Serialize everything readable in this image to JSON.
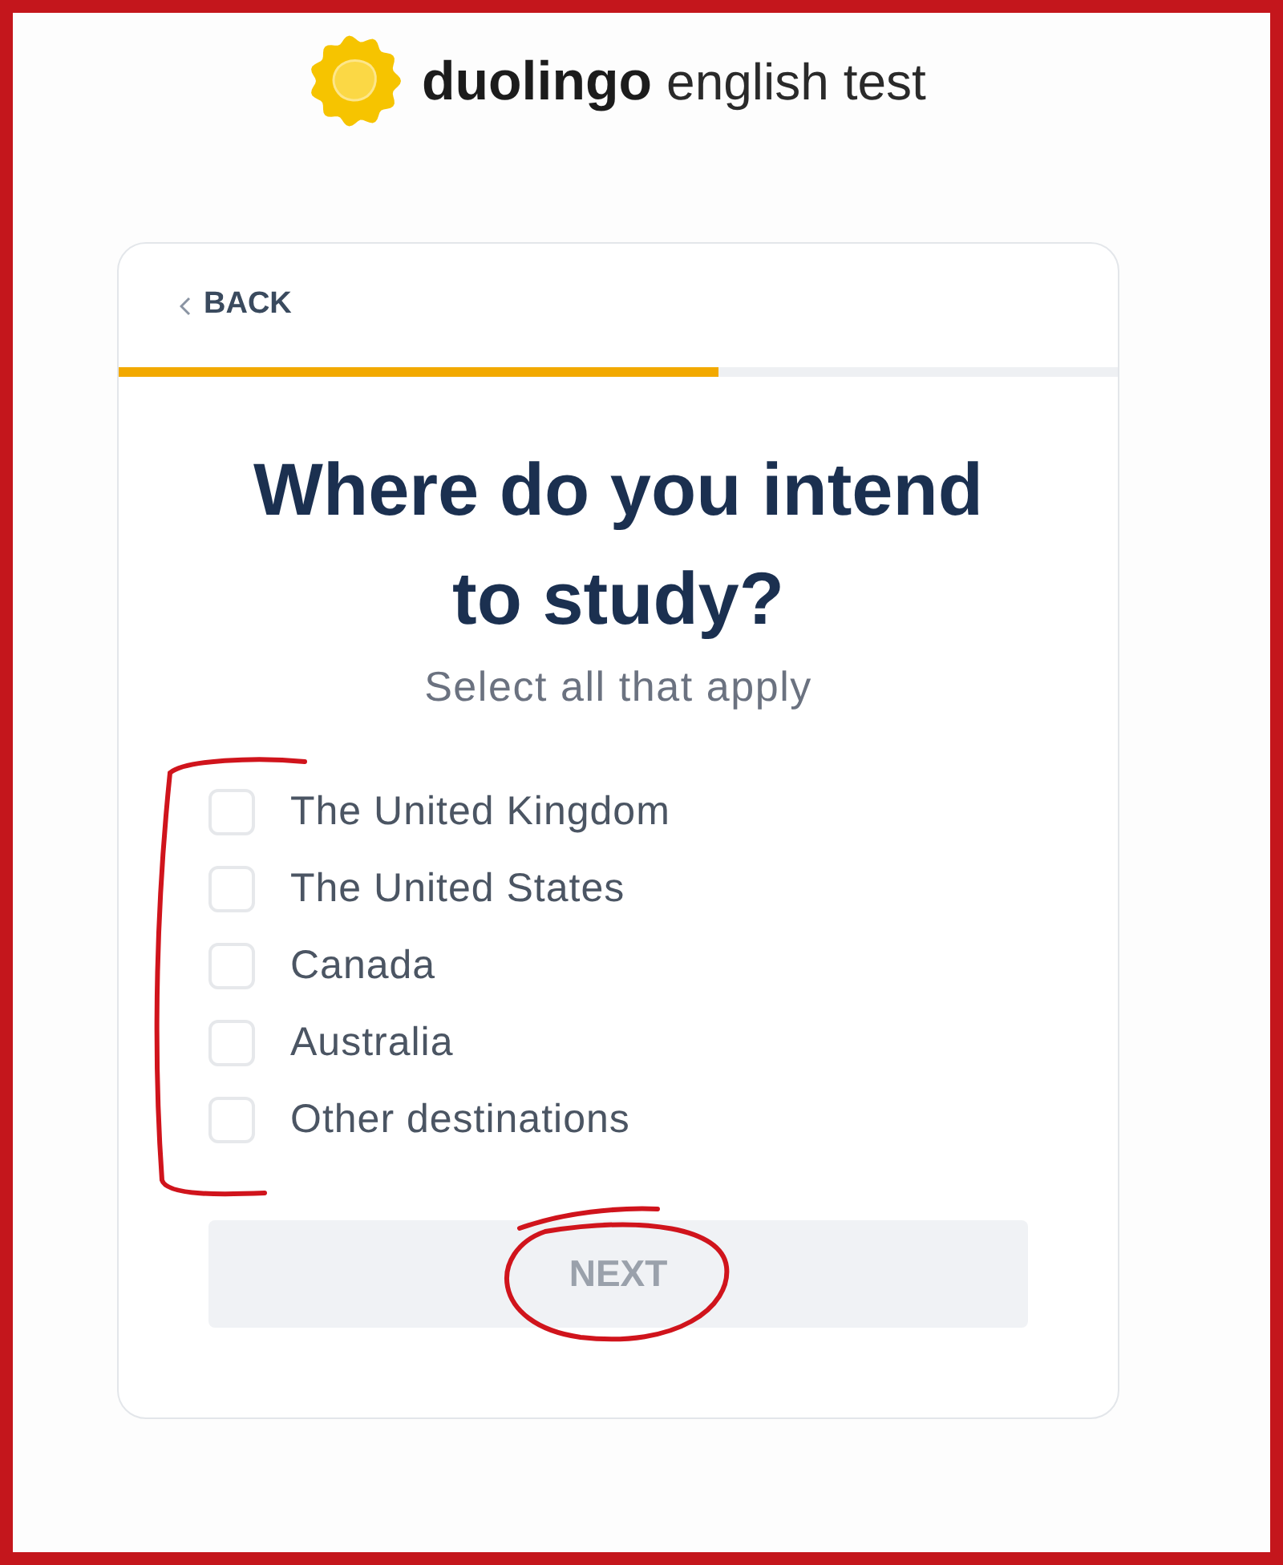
{
  "logo": {
    "wordmark_bold": "duolingo",
    "wordmark_rest": "english test"
  },
  "card": {
    "back_button": {
      "label": "BACK"
    },
    "progress": {
      "level": 0.6
    },
    "title": "Where do you intend to study?",
    "subtitle": "Select all that apply",
    "options": [
      {
        "label": "The United Kingdom",
        "checked": false
      },
      {
        "label": "The United States",
        "checked": false
      },
      {
        "label": "Canada",
        "checked": false
      },
      {
        "label": "Australia",
        "checked": false
      },
      {
        "label": "Other destinations",
        "checked": false
      }
    ],
    "next_button": {
      "label": "NEXT",
      "disabled": true
    }
  }
}
